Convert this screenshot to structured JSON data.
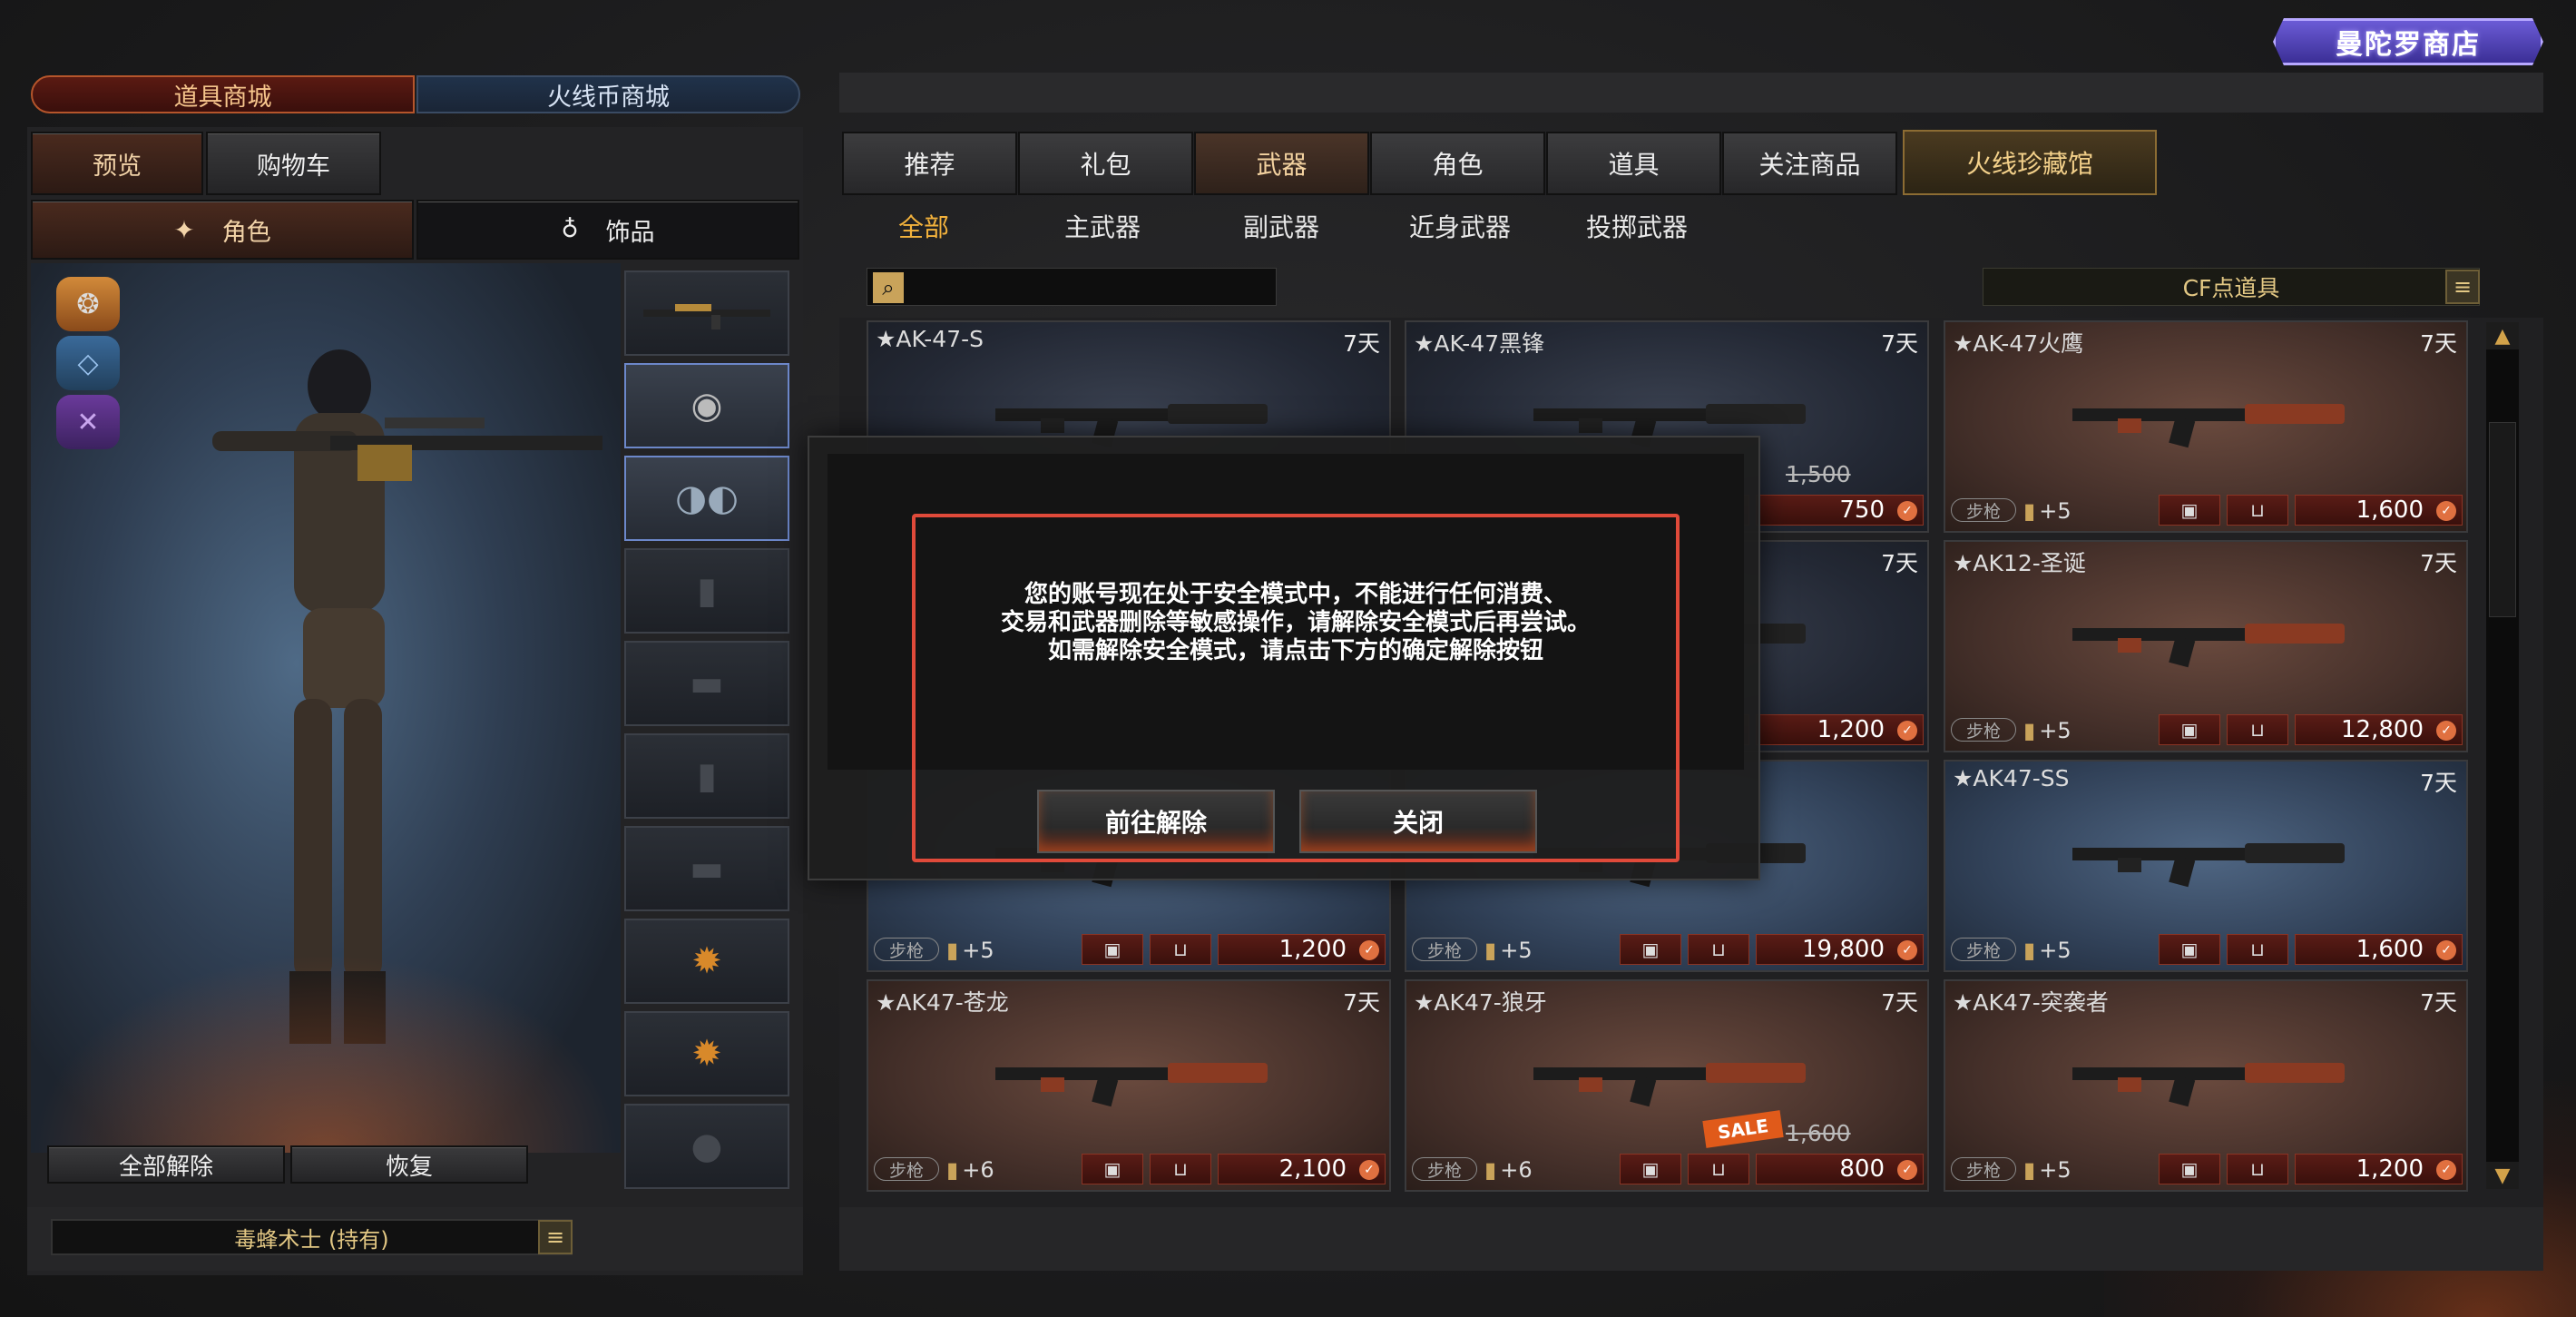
{
  "logo": {
    "text": "曼陀罗商店"
  },
  "shop_tabs": {
    "item_mall": "道具商城",
    "coin_mall": "火线币商城"
  },
  "left_tabs": {
    "preview": "预览",
    "cart": "购物车"
  },
  "sub_tabs": {
    "character": "角色",
    "accessory": "饰品"
  },
  "left_buttons": {
    "unequip_all": "全部解除",
    "restore": "恢复"
  },
  "owned_bar": {
    "text": "毒蜂术士 (持有)"
  },
  "nav_tabs": [
    "推荐",
    "礼包",
    "武器",
    "角色",
    "道具",
    "关注商品",
    "火线珍藏馆"
  ],
  "weapon_subtabs": [
    "全部",
    "主武器",
    "副武器",
    "近身武器",
    "投掷武器"
  ],
  "search": {
    "placeholder": ""
  },
  "filter": {
    "label": "CF点道具"
  },
  "products": [
    {
      "name": "★AK-47-S",
      "days": "7天",
      "category": "",
      "bonus": "",
      "price": "",
      "old_price": "",
      "sale": false,
      "theme": "c-dark"
    },
    {
      "name": "★AK-47黑锋",
      "days": "7天",
      "category": "",
      "bonus": "",
      "price": "750",
      "old_price": "1,500",
      "sale": false,
      "theme": "c-dark"
    },
    {
      "name": "★AK-47火鹰",
      "days": "7天",
      "category": "步枪",
      "bonus": "+5",
      "price": "1,600",
      "old_price": "",
      "sale": false,
      "theme": "c-red"
    },
    {
      "name": "",
      "days": "",
      "category": "",
      "bonus": "",
      "price": "",
      "old_price": "",
      "sale": false,
      "theme": "c-dark"
    },
    {
      "name": "",
      "days": "7天",
      "category": "",
      "bonus": "",
      "price": "1,200",
      "old_price": "",
      "sale": false,
      "theme": "c-dark"
    },
    {
      "name": "★AK12-圣诞",
      "days": "7天",
      "category": "步枪",
      "bonus": "+5",
      "price": "12,800",
      "old_price": "",
      "sale": false,
      "theme": "c-red"
    },
    {
      "name": "",
      "days": "",
      "category": "步枪",
      "bonus": "+5",
      "price": "1,200",
      "old_price": "",
      "sale": false,
      "theme": "c-blue"
    },
    {
      "name": "",
      "days": "",
      "category": "步枪",
      "bonus": "+5",
      "price": "19,800",
      "old_price": "",
      "sale": false,
      "theme": "c-blue"
    },
    {
      "name": "★AK47-SS",
      "days": "7天",
      "category": "步枪",
      "bonus": "+5",
      "price": "1,600",
      "old_price": "",
      "sale": false,
      "theme": "c-blue"
    },
    {
      "name": "★AK47-苍龙",
      "days": "7天",
      "category": "步枪",
      "bonus": "+6",
      "price": "2,100",
      "old_price": "",
      "sale": false,
      "theme": "c-red"
    },
    {
      "name": "★AK47-狼牙",
      "days": "7天",
      "category": "步枪",
      "bonus": "+6",
      "price": "800",
      "old_price": "1,600",
      "sale": true,
      "theme": "c-red"
    },
    {
      "name": "★AK47-突袭者",
      "days": "7天",
      "category": "步枪",
      "bonus": "+5",
      "price": "1,200",
      "old_price": "",
      "sale": false,
      "theme": "c-red"
    }
  ],
  "sale_text": "SALE",
  "modal": {
    "line1": "您的账号现在处于安全模式中，不能进行任何消费、",
    "line2": "交易和武器删除等敏感操作，请解除安全模式后再尝试。",
    "line3": "如需解除安全模式，请点击下方的确定解除按钮",
    "confirm": "前往解除",
    "close": "关闭"
  },
  "colors": {
    "accent": "#f3b23c",
    "highlight_border": "#e04a3a",
    "price_bg": "#5a1c16"
  }
}
